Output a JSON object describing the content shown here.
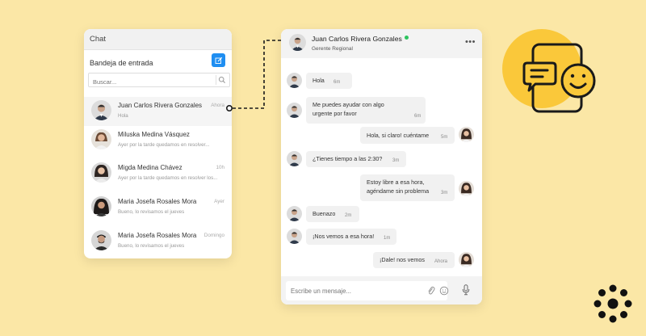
{
  "inbox": {
    "header": "Chat",
    "title": "Bandeja de entrada",
    "search_placeholder": "Buscar...",
    "contacts": [
      {
        "name": "Juan Carlos Rivera Gonzales",
        "preview": "Hola",
        "time": "Ahora"
      },
      {
        "name": "Miluska Medina Vásquez",
        "preview": "Ayer por la tarde quedamos en resolver...",
        "time": ""
      },
      {
        "name": "Migda Medina Chávez",
        "preview": "Ayer por la tarde quedamos en resolver los...",
        "time": "10h"
      },
      {
        "name": "Maria Josefa Rosales Mora",
        "preview": "Bueno, lo revisamos el jueves",
        "time": "Ayer"
      },
      {
        "name": "Maria Josefa Rosales Mora",
        "preview": "Bueno, lo revisamos el jueves",
        "time": "Domingo"
      }
    ]
  },
  "chat": {
    "name": "Juan Carlos Rivera Gonzales",
    "role": "Gerente Regional",
    "more": "•••",
    "messages": [
      {
        "side": "in",
        "lines": [
          "Hola"
        ],
        "time": "6m"
      },
      {
        "side": "in",
        "lines": [
          "Me puedes ayudar con algo",
          "urgente por favor"
        ],
        "time": "6m"
      },
      {
        "side": "out",
        "lines": [
          "Hola, si claro! cuéntame"
        ],
        "time": "5m"
      },
      {
        "side": "in",
        "lines": [
          "¿Tienes tiempo a las 2:30?"
        ],
        "time": "3m"
      },
      {
        "side": "out",
        "lines": [
          "Estoy libre a esa hora,",
          "agéndame sin problema"
        ],
        "time": "3m"
      },
      {
        "side": "in",
        "lines": [
          "Buenazo"
        ],
        "time": "2m"
      },
      {
        "side": "in",
        "lines": [
          "¡Nos vemos a esa hora!"
        ],
        "time": "1m"
      },
      {
        "side": "out",
        "lines": [
          "¡Dale! nos vemos"
        ],
        "time": "Ahora"
      }
    ],
    "composer_placeholder": "Escribe un mensaje..."
  },
  "colors": {
    "background": "#fbe7a6",
    "accent": "#1f8ef1",
    "online": "#2ec45f",
    "decor_circle": "#fac83a"
  },
  "icons": [
    "compose-icon",
    "search-icon",
    "attach-icon",
    "emoji-icon",
    "microphone-icon",
    "chat-phone-illustration",
    "brand-logo"
  ]
}
